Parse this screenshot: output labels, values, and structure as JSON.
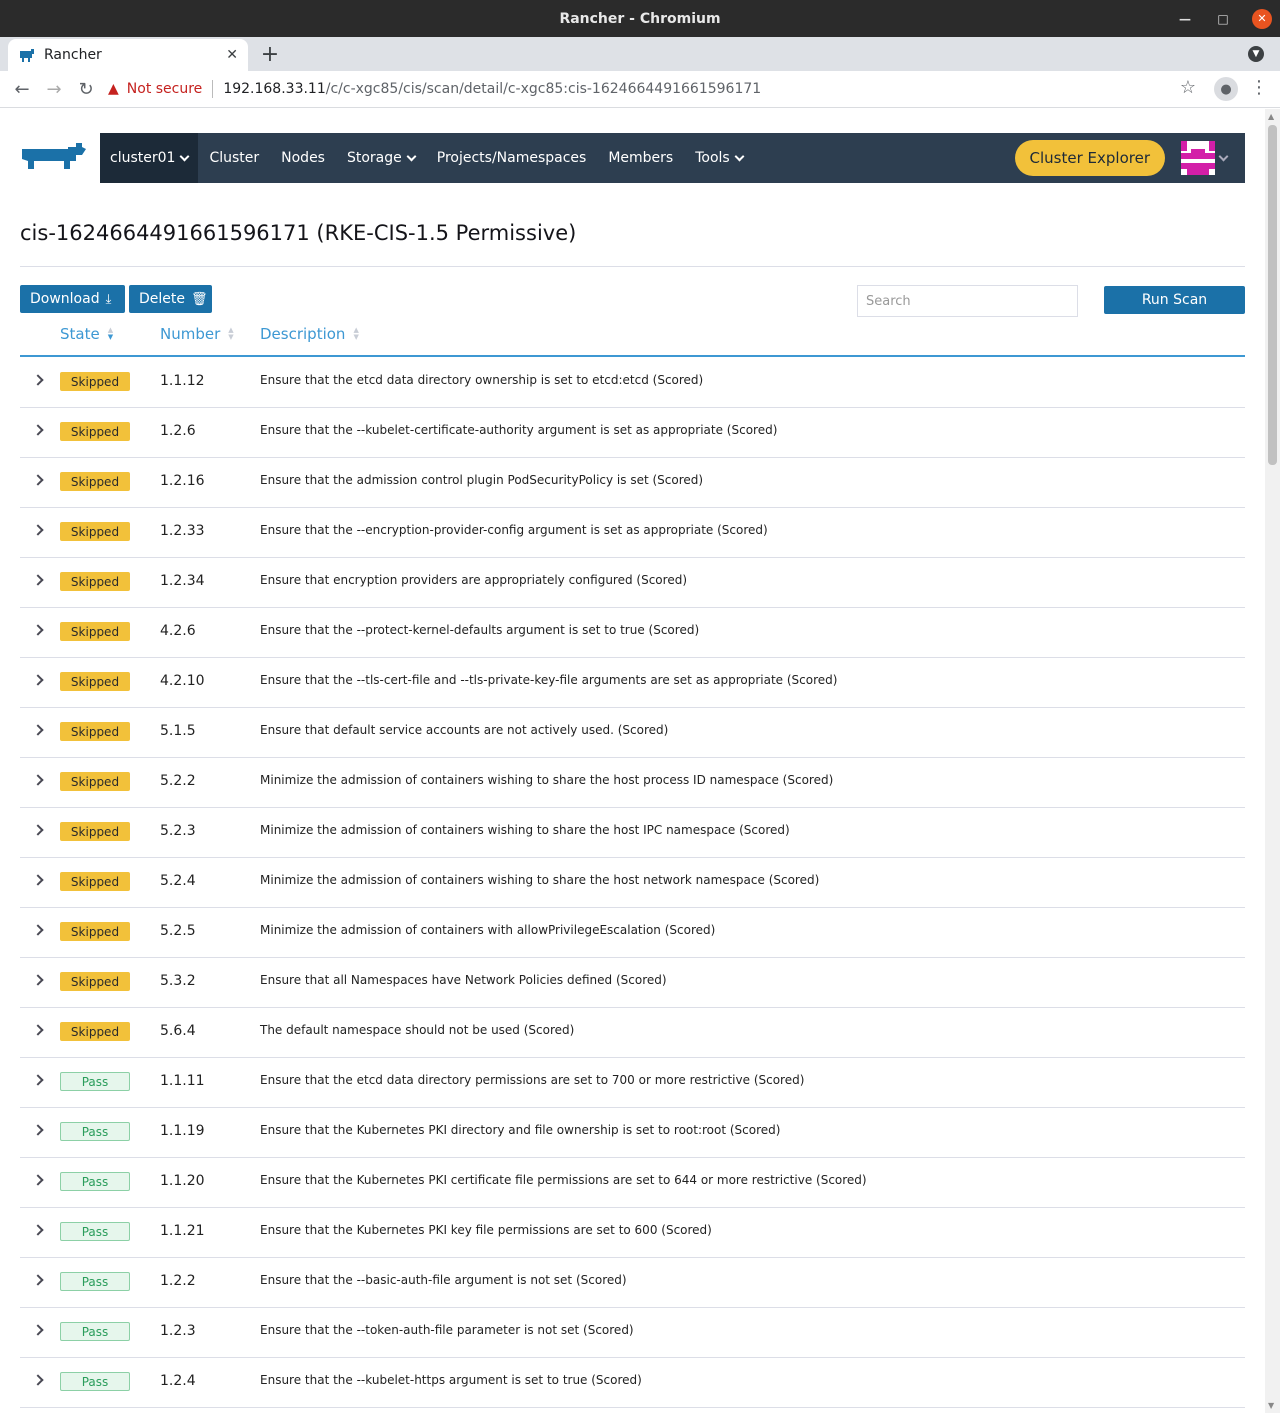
{
  "window": {
    "title": "Rancher - Chromium"
  },
  "browser": {
    "tab_title": "Rancher",
    "not_secure_label": "Not secure",
    "url_host": "192.168.33.11",
    "url_path": "/c/c-xgc85/cis/scan/detail/c-xgc85:cis-1624664491661596171"
  },
  "nav": {
    "cluster": "cluster01",
    "items": [
      "Cluster",
      "Nodes",
      "Storage",
      "Projects/Namespaces",
      "Members",
      "Tools"
    ],
    "cluster_explorer": "Cluster Explorer"
  },
  "page": {
    "title": "cis-1624664491661596171 (RKE-CIS-1.5 Permissive)",
    "download_label": "Download",
    "delete_label": "Delete",
    "search_placeholder": "Search",
    "run_scan_label": "Run Scan"
  },
  "table": {
    "headers": {
      "state": "State",
      "number": "Number",
      "description": "Description"
    },
    "rows": [
      {
        "state": "Skipped",
        "number": "1.1.12",
        "description": "Ensure that the etcd data directory ownership is set to etcd:etcd (Scored)"
      },
      {
        "state": "Skipped",
        "number": "1.2.6",
        "description": "Ensure that the --kubelet-certificate-authority argument is set as appropriate (Scored)"
      },
      {
        "state": "Skipped",
        "number": "1.2.16",
        "description": "Ensure that the admission control plugin PodSecurityPolicy is set (Scored)"
      },
      {
        "state": "Skipped",
        "number": "1.2.33",
        "description": "Ensure that the --encryption-provider-config argument is set as appropriate (Scored)"
      },
      {
        "state": "Skipped",
        "number": "1.2.34",
        "description": "Ensure that encryption providers are appropriately configured (Scored)"
      },
      {
        "state": "Skipped",
        "number": "4.2.6",
        "description": "Ensure that the --protect-kernel-defaults argument is set to true (Scored)"
      },
      {
        "state": "Skipped",
        "number": "4.2.10",
        "description": "Ensure that the --tls-cert-file and --tls-private-key-file arguments are set as appropriate (Scored)"
      },
      {
        "state": "Skipped",
        "number": "5.1.5",
        "description": "Ensure that default service accounts are not actively used. (Scored)"
      },
      {
        "state": "Skipped",
        "number": "5.2.2",
        "description": "Minimize the admission of containers wishing to share the host process ID namespace (Scored)"
      },
      {
        "state": "Skipped",
        "number": "5.2.3",
        "description": "Minimize the admission of containers wishing to share the host IPC namespace (Scored)"
      },
      {
        "state": "Skipped",
        "number": "5.2.4",
        "description": "Minimize the admission of containers wishing to share the host network namespace (Scored)"
      },
      {
        "state": "Skipped",
        "number": "5.2.5",
        "description": "Minimize the admission of containers with allowPrivilegeEscalation (Scored)"
      },
      {
        "state": "Skipped",
        "number": "5.3.2",
        "description": "Ensure that all Namespaces have Network Policies defined (Scored)"
      },
      {
        "state": "Skipped",
        "number": "5.6.4",
        "description": "The default namespace should not be used (Scored)"
      },
      {
        "state": "Pass",
        "number": "1.1.11",
        "description": "Ensure that the etcd data directory permissions are set to 700 or more restrictive (Scored)"
      },
      {
        "state": "Pass",
        "number": "1.1.19",
        "description": "Ensure that the Kubernetes PKI directory and file ownership is set to root:root (Scored)"
      },
      {
        "state": "Pass",
        "number": "1.1.20",
        "description": "Ensure that the Kubernetes PKI certificate file permissions are set to 644 or more restrictive (Scored)"
      },
      {
        "state": "Pass",
        "number": "1.1.21",
        "description": "Ensure that the Kubernetes PKI key file permissions are set to 600 (Scored)"
      },
      {
        "state": "Pass",
        "number": "1.2.2",
        "description": "Ensure that the --basic-auth-file argument is not set (Scored)"
      },
      {
        "state": "Pass",
        "number": "1.2.3",
        "description": "Ensure that the --token-auth-file parameter is not set (Scored)"
      },
      {
        "state": "Pass",
        "number": "1.2.4",
        "description": "Ensure that the --kubelet-https argument is set to true (Scored)"
      }
    ]
  },
  "colors": {
    "nav_bg": "#2d3e50",
    "accent": "#1b71a8",
    "header_link": "#3d98d3",
    "skipped": "#f2c13a",
    "pass": "#2a9d5b"
  }
}
